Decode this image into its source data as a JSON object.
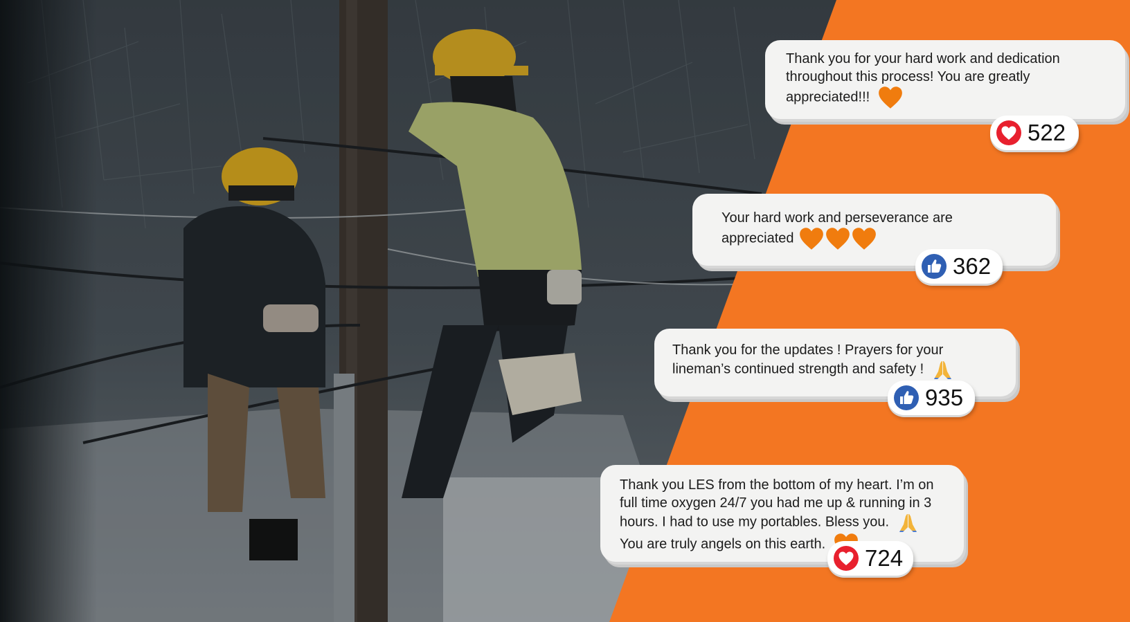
{
  "brand": {
    "accent": "#f37622",
    "heart": "#e8202e",
    "like": "#2f5fb3"
  },
  "comments": [
    {
      "lines": [
        "Thank you for your hard work and dedication",
        "throughout this process! You are greatly",
        "appreciated!!!"
      ],
      "emoji": "orange-heart-icon",
      "reaction": {
        "icon": "heart-reaction-icon",
        "count": "522"
      }
    },
    {
      "lines": [
        "Your hard work and perseverance are",
        "appreciated"
      ],
      "emoji": "orange-heart-icon x3",
      "reaction": {
        "icon": "like-reaction-icon",
        "count": "362"
      }
    },
    {
      "lines": [
        "Thank you for the updates ! Prayers for your",
        "lineman’s continued strength and safety !"
      ],
      "emoji": "praying-hands-icon",
      "reaction": {
        "icon": "like-reaction-icon",
        "count": "935"
      }
    },
    {
      "lines": [
        "Thank you LES from the bottom of my heart. I’m on",
        "full time oxygen 24/7 you had me up & running in 3",
        "hours. I had to use my portables. Bless you.",
        "You are truly angels on this earth."
      ],
      "emoji": "praying-hands-icon, orange-heart-icon",
      "reaction": {
        "icon": "heart-reaction-icon",
        "count": "724"
      }
    }
  ]
}
